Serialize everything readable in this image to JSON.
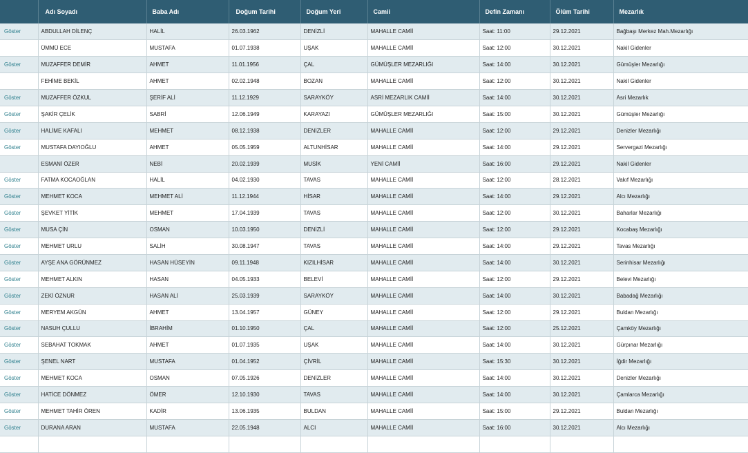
{
  "table": {
    "headers": [
      "",
      "Adı Soyadı",
      "Baba Adı",
      "Doğum Tarihi",
      "Doğum Yeri",
      "Camii",
      "Defin Zamanı",
      "Ölüm Tarihi",
      "Mezarlık"
    ],
    "show_label": "Göster",
    "rows": [
      {
        "show": true,
        "name": "ABDULLAH DİLENÇ",
        "father": "HALİL",
        "birth_date": "26.03.1962",
        "birth_place": "DENİZLİ",
        "mosque": "MAHALLE CAMİİ",
        "burial": "Saat: 11:00",
        "death_date": "29.12.2021",
        "cemetery": "Bağbaşı Merkez Mah.Mezarlığı"
      },
      {
        "show": false,
        "name": "ÜMMÜ ECE",
        "father": "MUSTAFA",
        "birth_date": "01.07.1938",
        "birth_place": "UŞAK",
        "mosque": "MAHALLE CAMİİ",
        "burial": "Saat: 12:00",
        "death_date": "30.12.2021",
        "cemetery": "Nakil Gidenler"
      },
      {
        "show": true,
        "name": "MUZAFFER DEMİR",
        "father": "AHMET",
        "birth_date": "11.01.1956",
        "birth_place": "ÇAL",
        "mosque": "GÜMÜŞLER MEZARLIĞI",
        "burial": "Saat: 14:00",
        "death_date": "30.12.2021",
        "cemetery": "Gümüşler Mezarlığı"
      },
      {
        "show": false,
        "name": "FEHİME BEKİL",
        "father": "AHMET",
        "birth_date": "02.02.1948",
        "birth_place": "BOZAN",
        "mosque": "MAHALLE CAMİİ",
        "burial": "Saat: 12:00",
        "death_date": "30.12.2021",
        "cemetery": "Nakil Gidenler"
      },
      {
        "show": true,
        "name": "MUZAFFER ÖZKUL",
        "father": "ŞERİF ALİ",
        "birth_date": "11.12.1929",
        "birth_place": "SARAYKÖY",
        "mosque": "ASRİ MEZARLIK CAMİİ",
        "burial": "Saat: 14:00",
        "death_date": "30.12.2021",
        "cemetery": "Asri Mezarlık"
      },
      {
        "show": true,
        "name": "ŞAKİR ÇELİK",
        "father": "SABRİ",
        "birth_date": "12.06.1949",
        "birth_place": "KARAYAZI",
        "mosque": "GÜMÜŞLER MEZARLIĞI",
        "burial": "Saat: 15:00",
        "death_date": "30.12.2021",
        "cemetery": "Gümüşler Mezarlığı"
      },
      {
        "show": true,
        "name": "HALİME KAFALI",
        "father": "MEHMET",
        "birth_date": "08.12.1938",
        "birth_place": "DENİZLER",
        "mosque": "MAHALLE CAMİİ",
        "burial": "Saat: 12:00",
        "death_date": "29.12.2021",
        "cemetery": "Denizler Mezarlığı"
      },
      {
        "show": true,
        "name": "MUSTAFA DAYIOĞLU",
        "father": "AHMET",
        "birth_date": "05.05.1959",
        "birth_place": "ALTUNHİSAR",
        "mosque": "MAHALLE CAMİİ",
        "burial": "Saat: 14:00",
        "death_date": "29.12.2021",
        "cemetery": "Servergazi Mezarlığı"
      },
      {
        "show": false,
        "name": "ESMANİ ÖZER",
        "father": "NEBİ",
        "birth_date": "20.02.1939",
        "birth_place": "MUSİK",
        "mosque": "YENİ CAMİİ",
        "burial": "Saat: 16:00",
        "death_date": "29.12.2021",
        "cemetery": "Nakil Gidenler"
      },
      {
        "show": true,
        "name": "FATMA KOCAOĞLAN",
        "father": "HALİL",
        "birth_date": "04.02.1930",
        "birth_place": "TAVAS",
        "mosque": "MAHALLE CAMİİ",
        "burial": "Saat: 12:00",
        "death_date": "28.12.2021",
        "cemetery": "Vakıf Mezarlığı"
      },
      {
        "show": true,
        "name": "MEHMET KOCA",
        "father": "MEHMET ALİ",
        "birth_date": "11.12.1944",
        "birth_place": "HİSAR",
        "mosque": "MAHALLE CAMİİ",
        "burial": "Saat: 14:00",
        "death_date": "29.12.2021",
        "cemetery": "Alcı Mezarlığı"
      },
      {
        "show": true,
        "name": "ŞEVKET YİTİK",
        "father": "MEHMET",
        "birth_date": "17.04.1939",
        "birth_place": "TAVAS",
        "mosque": "MAHALLE CAMİİ",
        "burial": "Saat: 12:00",
        "death_date": "30.12.2021",
        "cemetery": "Baharlar Mezarlığı"
      },
      {
        "show": true,
        "name": "MUSA ÇİN",
        "father": "OSMAN",
        "birth_date": "10.03.1950",
        "birth_place": "DENİZLİ",
        "mosque": "MAHALLE CAMİİ",
        "burial": "Saat: 12:00",
        "death_date": "29.12.2021",
        "cemetery": "Kocabaş Mezarlığı"
      },
      {
        "show": true,
        "name": "MEHMET URLU",
        "father": "SALİH",
        "birth_date": "30.08.1947",
        "birth_place": "TAVAS",
        "mosque": "MAHALLE CAMİİ",
        "burial": "Saat: 14:00",
        "death_date": "29.12.2021",
        "cemetery": "Tavas Mezarlığı"
      },
      {
        "show": true,
        "name": "AYŞE ANA GÖRÜNMEZ",
        "father": "HASAN HÜSEYİN",
        "birth_date": "09.11.1948",
        "birth_place": "KIZILHİSAR",
        "mosque": "MAHALLE CAMİİ",
        "burial": "Saat: 14:00",
        "death_date": "30.12.2021",
        "cemetery": "Serinhisar Mezarlığı"
      },
      {
        "show": true,
        "name": "MEHMET ALKIN",
        "father": "HASAN",
        "birth_date": "04.05.1933",
        "birth_place": "BELEVİ",
        "mosque": "MAHALLE CAMİİ",
        "burial": "Saat: 12:00",
        "death_date": "29.12.2021",
        "cemetery": "Belevi Mezarlığı"
      },
      {
        "show": true,
        "name": "ZEKİ ÖZNUR",
        "father": "HASAN ALİ",
        "birth_date": "25.03.1939",
        "birth_place": "SARAYKÖY",
        "mosque": "MAHALLE CAMİİ",
        "burial": "Saat: 14:00",
        "death_date": "30.12.2021",
        "cemetery": "Babadağ Mezarlığı"
      },
      {
        "show": true,
        "name": "MERYEM AKGÜN",
        "father": "AHMET",
        "birth_date": "13.04.1957",
        "birth_place": "GÜNEY",
        "mosque": "MAHALLE CAMİİ",
        "burial": "Saat: 12:00",
        "death_date": "29.12.2021",
        "cemetery": "Buldan Mezarlığı"
      },
      {
        "show": true,
        "name": "NASUH ÇULLU",
        "father": "İBRAHİM",
        "birth_date": "01.10.1950",
        "birth_place": "ÇAL",
        "mosque": "MAHALLE CAMİİ",
        "burial": "Saat: 12:00",
        "death_date": "25.12.2021",
        "cemetery": "Çamköy Mezarlığı"
      },
      {
        "show": true,
        "name": "SEBAHAT TOKMAK",
        "father": "AHMET",
        "birth_date": "01.07.1935",
        "birth_place": "UŞAK",
        "mosque": "MAHALLE CAMİİ",
        "burial": "Saat: 14:00",
        "death_date": "30.12.2021",
        "cemetery": "Gürpınar Mezarlığı"
      },
      {
        "show": true,
        "name": "ŞENEL NART",
        "father": "MUSTAFA",
        "birth_date": "01.04.1952",
        "birth_place": "ÇİVRİL",
        "mosque": "MAHALLE CAMİİ",
        "burial": "Saat: 15:30",
        "death_date": "30.12.2021",
        "cemetery": "İğdir Mezarlığı"
      },
      {
        "show": true,
        "name": "MEHMET KOCA",
        "father": "OSMAN",
        "birth_date": "07.05.1926",
        "birth_place": "DENİZLER",
        "mosque": "MAHALLE CAMİİ",
        "burial": "Saat: 14:00",
        "death_date": "30.12.2021",
        "cemetery": "Denizler Mezarlığı"
      },
      {
        "show": true,
        "name": "HATİCE DÖNMEZ",
        "father": "ÖMER",
        "birth_date": "12.10.1930",
        "birth_place": "TAVAS",
        "mosque": "MAHALLE CAMİİ",
        "burial": "Saat: 14:00",
        "death_date": "30.12.2021",
        "cemetery": "Çamlarca Mezarlığı"
      },
      {
        "show": true,
        "name": "MEHMET TAHİR ÖREN",
        "father": "KADİR",
        "birth_date": "13.06.1935",
        "birth_place": "BULDAN",
        "mosque": "MAHALLE CAMİİ",
        "burial": "Saat: 15:00",
        "death_date": "29.12.2021",
        "cemetery": "Buldan Mezarlığı"
      },
      {
        "show": true,
        "name": "DURANA ARAN",
        "father": "MUSTAFA",
        "birth_date": "22.05.1948",
        "birth_place": "ALCI",
        "mosque": "MAHALLE CAMİİ",
        "burial": "Saat: 16:00",
        "death_date": "30.12.2021",
        "cemetery": "Alcı Mezarlığı"
      }
    ]
  },
  "colors": {
    "header_bg": "#2f5d73",
    "row_alt_bg": "#e1ebef",
    "link": "#2d7f8d"
  }
}
